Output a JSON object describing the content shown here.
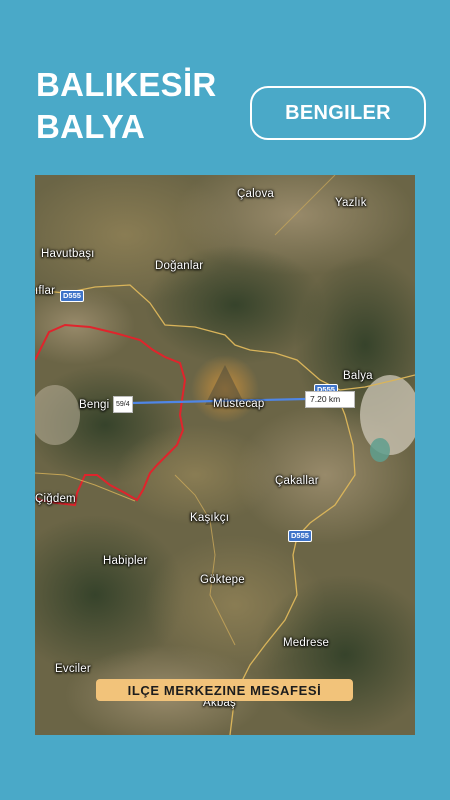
{
  "header": {
    "title_line1": "BALIKESİR",
    "title_line2": "BALYA",
    "location_button": "BENGILER"
  },
  "map": {
    "places": {
      "calova": "Çalova",
      "yazlik": "Yazlık",
      "havutbasi": "Havutbaşı",
      "doganlar": "Doğanlar",
      "cilar": "ıflar",
      "bengi": "Bengi",
      "mustecap": "Müstecap",
      "balya": "Balya",
      "cakallar": "Çakallar",
      "cigdem": "Çiğdem",
      "kasikci": "Kaşıkçı",
      "habipler": "Habipler",
      "goktepe": "Göktepe",
      "medrese": "Medrese",
      "evciler": "Evciler",
      "akbas": "Akbaş"
    },
    "roads": {
      "d555_top": "D555",
      "d555_right": "D555",
      "d555_bottom": "D555"
    },
    "measure_start_label": "59/4",
    "distance_label": "7.20 km",
    "route_color": "#4f86e6",
    "border_color": "#e0242c",
    "road_line_color": "#d9b45a",
    "banner": "ILÇE MERKEZINE MESAFESİ"
  }
}
